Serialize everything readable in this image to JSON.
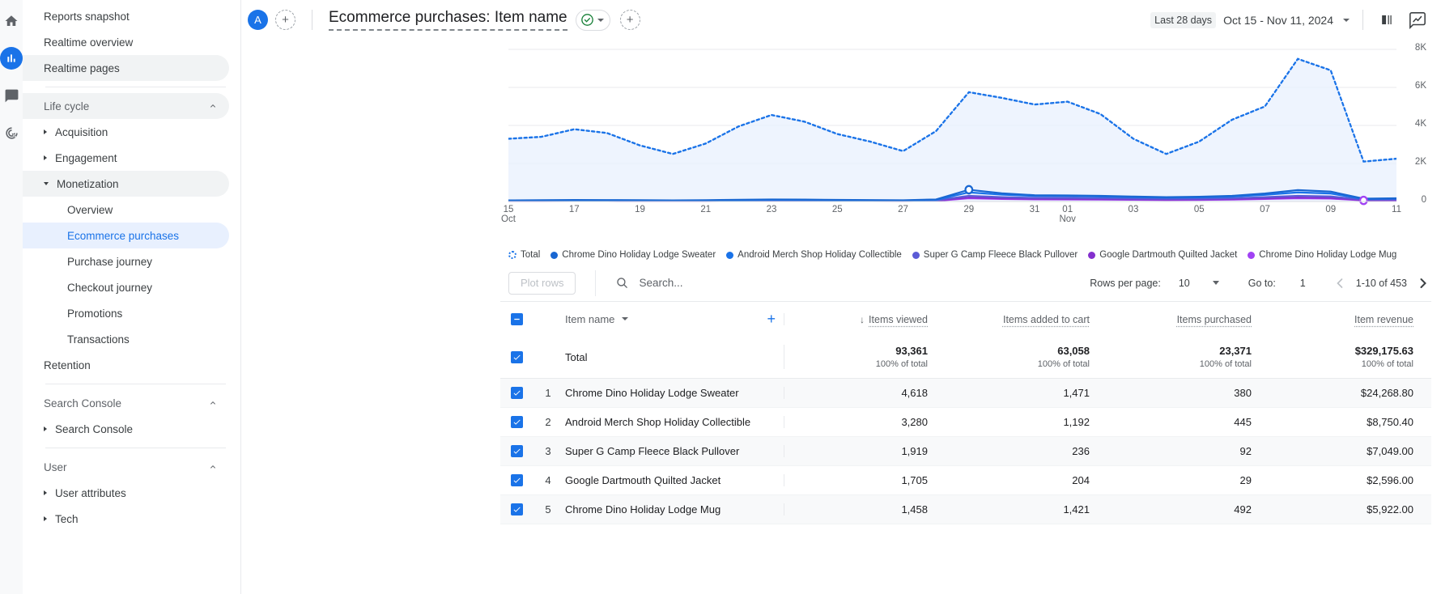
{
  "rail": {
    "items": [
      {
        "name": "home-icon",
        "label": "Home"
      },
      {
        "name": "reports-icon",
        "label": "Reports"
      },
      {
        "name": "explore-icon",
        "label": "Explore"
      },
      {
        "name": "advertising-icon",
        "label": "Advertising"
      }
    ]
  },
  "sidebar": {
    "items": [
      {
        "label": "Reports snapshot",
        "type": "item",
        "state": "normal"
      },
      {
        "label": "Realtime overview",
        "type": "item",
        "state": "normal"
      },
      {
        "label": "Realtime pages",
        "type": "item",
        "state": "hover"
      },
      {
        "label": "Life cycle",
        "type": "section",
        "state": "hover",
        "expanded": true
      },
      {
        "label": "Acquisition",
        "type": "group",
        "state": "normal",
        "expanded": false
      },
      {
        "label": "Engagement",
        "type": "group",
        "state": "normal",
        "expanded": false
      },
      {
        "label": "Monetization",
        "type": "group",
        "state": "hover",
        "expanded": true
      },
      {
        "label": "Overview",
        "type": "sub",
        "state": "normal"
      },
      {
        "label": "Ecommerce purchases",
        "type": "sub",
        "state": "selected"
      },
      {
        "label": "Purchase journey",
        "type": "sub",
        "state": "normal"
      },
      {
        "label": "Checkout journey",
        "type": "sub",
        "state": "normal"
      },
      {
        "label": "Promotions",
        "type": "sub",
        "state": "normal"
      },
      {
        "label": "Transactions",
        "type": "sub",
        "state": "normal"
      },
      {
        "label": "Retention",
        "type": "item",
        "state": "normal"
      },
      {
        "label": "Search Console",
        "type": "section",
        "state": "normal",
        "expanded": true
      },
      {
        "label": "Search Console",
        "type": "group",
        "state": "normal",
        "expanded": false
      },
      {
        "label": "User",
        "type": "section",
        "state": "normal",
        "expanded": true
      },
      {
        "label": "User attributes",
        "type": "group",
        "state": "normal",
        "expanded": false
      },
      {
        "label": "Tech",
        "type": "group",
        "state": "normal",
        "expanded": false
      }
    ]
  },
  "topbar": {
    "avatar_letter": "A",
    "add_account_label": "+",
    "title": "Ecommerce purchases: Item name",
    "add_comparison_label": "+",
    "date_chip": "Last 28 days",
    "date_range": "Oct 15 - Nov 11, 2024",
    "icons": [
      "check-circle-icon",
      "chevron-down-icon",
      "plus-icon",
      "compare-icon",
      "insights-icon"
    ]
  },
  "chart_data": {
    "type": "line",
    "title": "",
    "xlabel": "",
    "ylabel": "",
    "ylim": [
      0,
      8000
    ],
    "yticks": [
      0,
      2000,
      4000,
      6000,
      8000
    ],
    "ytick_labels": [
      "0",
      "2K",
      "4K",
      "6K",
      "8K"
    ],
    "grid": true,
    "legend_position": "bottom",
    "x": [
      "15",
      "16",
      "17",
      "18",
      "19",
      "20",
      "21",
      "22",
      "23",
      "24",
      "25",
      "26",
      "27",
      "28",
      "29",
      "30",
      "31",
      "01",
      "02",
      "03",
      "04",
      "05",
      "06",
      "07",
      "08",
      "09",
      "10",
      "11"
    ],
    "xtick_labels": [
      "15",
      "17",
      "19",
      "21",
      "23",
      "25",
      "27",
      "29",
      "31",
      "01",
      "03",
      "05",
      "07",
      "09",
      "11"
    ],
    "xtick_sublabels": {
      "15": "Oct",
      "01": "Nov"
    },
    "series": [
      {
        "name": "Total",
        "color": "#1a73e8",
        "style": "dotted",
        "filled": true,
        "values": [
          3300,
          3400,
          3800,
          3600,
          2950,
          2500,
          3050,
          3950,
          4550,
          4200,
          3550,
          3150,
          2650,
          3700,
          5750,
          5450,
          5100,
          5250,
          4600,
          3300,
          2500,
          3150,
          4300,
          5000,
          7500,
          6900,
          2100,
          2250
        ]
      },
      {
        "name": "Chrome Dino Holiday Lodge Sweater",
        "color": "#1967d2",
        "style": "solid",
        "values": [
          60,
          70,
          80,
          75,
          70,
          60,
          70,
          90,
          110,
          100,
          85,
          75,
          65,
          110,
          620,
          430,
          330,
          320,
          300,
          260,
          230,
          250,
          300,
          420,
          600,
          520,
          150,
          170
        ]
      },
      {
        "name": "Android Merch Shop Holiday Collectible",
        "color": "#1a73e8",
        "style": "solid",
        "values": [
          50,
          55,
          60,
          58,
          55,
          50,
          56,
          70,
          85,
          80,
          68,
          60,
          52,
          85,
          480,
          360,
          290,
          285,
          260,
          225,
          200,
          215,
          255,
          350,
          480,
          420,
          130,
          150
        ]
      },
      {
        "name": "Super G Camp Fleece Black Pullover",
        "color": "#5b5bd6",
        "style": "solid",
        "values": [
          35,
          38,
          42,
          40,
          38,
          34,
          38,
          48,
          58,
          54,
          46,
          41,
          36,
          58,
          300,
          230,
          190,
          185,
          170,
          150,
          135,
          145,
          170,
          230,
          300,
          265,
          95,
          105
        ]
      },
      {
        "name": "Google Dartmouth Quilted Jacket",
        "color": "#8430ce",
        "style": "solid",
        "values": [
          25,
          27,
          30,
          29,
          27,
          24,
          27,
          34,
          41,
          38,
          33,
          29,
          26,
          41,
          210,
          165,
          135,
          132,
          122,
          108,
          97,
          104,
          122,
          165,
          210,
          188,
          70,
          78
        ]
      },
      {
        "name": "Chrome Dino Holiday Lodge Mug",
        "color": "#a142f4",
        "style": "solid",
        "values": [
          20,
          22,
          24,
          23,
          22,
          20,
          22,
          27,
          33,
          30,
          26,
          23,
          21,
          33,
          170,
          134,
          110,
          107,
          99,
          88,
          79,
          85,
          99,
          134,
          170,
          152,
          58,
          64
        ]
      }
    ]
  },
  "toolbar": {
    "plot_rows_label": "Plot rows",
    "search_placeholder": "Search...",
    "rows_per_page_label": "Rows per page:",
    "rows_per_page_value": "10",
    "go_to_label": "Go to:",
    "go_to_value": "1",
    "page_range": "1-10 of 453"
  },
  "table": {
    "dimension_header": "Item name",
    "add_dimension_label": "+",
    "metric_headers": [
      {
        "label": "Items viewed",
        "sorted": true,
        "sort_dir": "desc"
      },
      {
        "label": "Items added to cart",
        "sorted": false
      },
      {
        "label": "Items purchased",
        "sorted": false
      },
      {
        "label": "Item revenue",
        "sorted": false
      }
    ],
    "total_row": {
      "label": "Total",
      "values": [
        "93,361",
        "63,058",
        "23,371",
        "$329,175.63"
      ],
      "subs": [
        "100% of total",
        "100% of total",
        "100% of total",
        "100% of total"
      ]
    },
    "rows": [
      {
        "index": "1",
        "name": "Chrome Dino Holiday Lodge Sweater",
        "values": [
          "4,618",
          "1,471",
          "380",
          "$24,268.80"
        ]
      },
      {
        "index": "2",
        "name": "Android Merch Shop Holiday Collectible",
        "values": [
          "3,280",
          "1,192",
          "445",
          "$8,750.40"
        ]
      },
      {
        "index": "3",
        "name": "Super G Camp Fleece Black Pullover",
        "values": [
          "1,919",
          "236",
          "92",
          "$7,049.00"
        ]
      },
      {
        "index": "4",
        "name": "Google Dartmouth Quilted Jacket",
        "values": [
          "1,705",
          "204",
          "29",
          "$2,596.00"
        ]
      },
      {
        "index": "5",
        "name": "Chrome Dino Holiday Lodge Mug",
        "values": [
          "1,458",
          "1,421",
          "492",
          "$5,922.00"
        ]
      }
    ]
  },
  "colors": {
    "accent": "#1a73e8",
    "selected_bg": "#e8f0fe",
    "hover_bg": "#f1f3f4",
    "text": "#202124",
    "muted": "#5f6368"
  }
}
